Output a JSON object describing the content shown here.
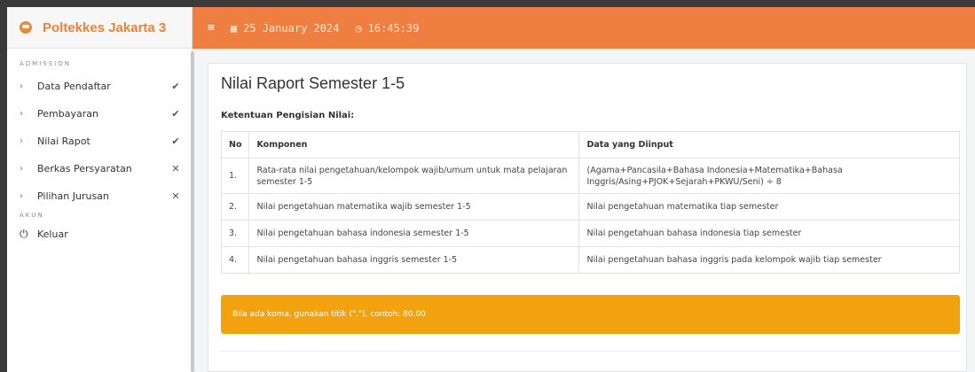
{
  "brand": {
    "name": "Poltekkes Jakarta 3"
  },
  "topbar": {
    "date": "25 January 2024",
    "time": "16:45:39"
  },
  "sidebar": {
    "section_admission": "ADMISSION",
    "items": [
      {
        "label": "Data Pendaftar",
        "status": "✔"
      },
      {
        "label": "Pembayaran",
        "status": "✔"
      },
      {
        "label": "Nilai Rapot",
        "status": "✔"
      },
      {
        "label": "Berkas Persyaratan",
        "status": "✕"
      },
      {
        "label": "Pilihan Jurusan",
        "status": "✕"
      }
    ],
    "section_akun": "AKUN",
    "logout": "Keluar"
  },
  "main": {
    "title": "Nilai Raport Semester 1-5",
    "subheading": "Ketentuan Pengisian Nilai:",
    "table": {
      "headers": [
        "No",
        "Komponen",
        "Data yang Diinput"
      ],
      "rows": [
        [
          "1.",
          "Rata-rata nilai pengetahuan/kelompok wajib/umum untuk mata pelajaran semester 1-5",
          "(Agama+Pancasila+Bahasa Indonesia+Matematika+Bahasa Inggris/Asing+PJOK+Sejarah+PKWU/Seni) ÷ 8"
        ],
        [
          "2.",
          "Nilai pengetahuan matematika wajib semester 1-5",
          "Nilai pengetahuan matematika tiap semester"
        ],
        [
          "3.",
          "Nilai pengetahuan bahasa indonesia semester 1-5",
          "Nilai pengetahuan bahasa indonesia tiap semester"
        ],
        [
          "4.",
          "Nilai pengetahuan bahasa inggris semester 1-5",
          "Nilai pengetahuan bahasa inggris pada kelompok wajib tiap semester"
        ]
      ]
    },
    "alert": "Bila ada koma, gunakan titik (\".\"), contoh: 80.00"
  },
  "colors": {
    "accent": "#ee7f40",
    "brand_text": "#e8843a",
    "alert": "#f2a20f"
  }
}
